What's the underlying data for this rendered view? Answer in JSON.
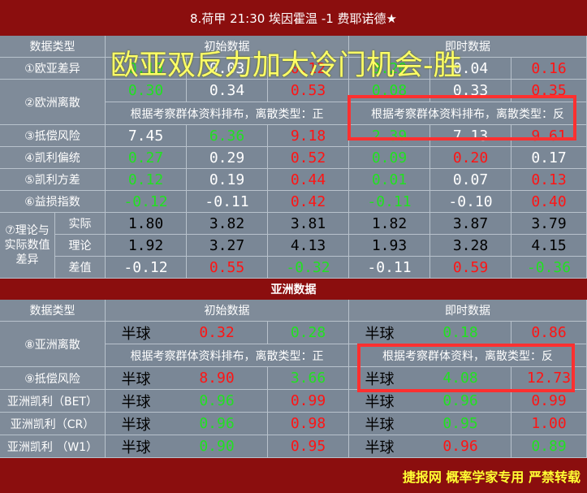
{
  "header": {
    "title": "8.荷甲 21:30 埃因霍温 -1 费耶诺德★"
  },
  "overlay_text": "欧亚双反力加大冷门机会-胜",
  "europe": {
    "col_labels": {
      "type": "数据类型",
      "initial": "初始数据",
      "live": "即时数据"
    },
    "rows": [
      {
        "label": "①欧亚差异",
        "cells": [
          {
            "v": "0.10",
            "c": "green"
          },
          {
            "v": "0.03",
            "c": "white"
          },
          {
            "v": "0.12",
            "c": "red"
          },
          {
            "v": "0.20",
            "c": "green"
          },
          {
            "v": "0.04",
            "c": "white"
          },
          {
            "v": "0.16",
            "c": "red"
          }
        ]
      },
      {
        "label": "②欧洲离散",
        "cells": [
          {
            "v": "0.30",
            "c": "green"
          },
          {
            "v": "0.34",
            "c": "white"
          },
          {
            "v": "0.53",
            "c": "red"
          },
          {
            "v": "0.08",
            "c": "green"
          },
          {
            "v": "0.33",
            "c": "white"
          },
          {
            "v": "0.35",
            "c": "red"
          }
        ],
        "notes": [
          "根据考察群体资料排布，离散类型：正",
          "根据考察群体资料排布，离散类型：反"
        ]
      },
      {
        "label": "③抵偿风险",
        "cells": [
          {
            "v": "7.45",
            "c": "white"
          },
          {
            "v": "6.36",
            "c": "green"
          },
          {
            "v": "9.18",
            "c": "red"
          },
          {
            "v": "2.39",
            "c": "green"
          },
          {
            "v": "7.13",
            "c": "white"
          },
          {
            "v": "9.61",
            "c": "red"
          }
        ]
      },
      {
        "label": "④凯利偏统",
        "cells": [
          {
            "v": "0.27",
            "c": "green"
          },
          {
            "v": "0.29",
            "c": "white"
          },
          {
            "v": "0.52",
            "c": "red"
          },
          {
            "v": "0.09",
            "c": "green"
          },
          {
            "v": "0.20",
            "c": "red"
          },
          {
            "v": "0.17",
            "c": "white"
          }
        ]
      },
      {
        "label": "⑤凯利方差",
        "cells": [
          {
            "v": "0.12",
            "c": "green"
          },
          {
            "v": "0.19",
            "c": "white"
          },
          {
            "v": "0.44",
            "c": "red"
          },
          {
            "v": "0.01",
            "c": "green"
          },
          {
            "v": "0.07",
            "c": "white"
          },
          {
            "v": "0.13",
            "c": "red"
          }
        ]
      },
      {
        "label": "⑥益损指数",
        "cells": [
          {
            "v": "-0.12",
            "c": "green"
          },
          {
            "v": "-0.11",
            "c": "white"
          },
          {
            "v": "0.42",
            "c": "red"
          },
          {
            "v": "-0.11",
            "c": "green"
          },
          {
            "v": "-0.10",
            "c": "white"
          },
          {
            "v": "0.40",
            "c": "red"
          }
        ]
      }
    ],
    "theory": {
      "label": "⑦理论与实际数值差异",
      "rows": [
        {
          "label": "实际",
          "cells": [
            {
              "v": "1.80",
              "c": "black"
            },
            {
              "v": "3.82",
              "c": "black"
            },
            {
              "v": "3.81",
              "c": "black"
            },
            {
              "v": "1.82",
              "c": "black"
            },
            {
              "v": "3.87",
              "c": "black"
            },
            {
              "v": "3.79",
              "c": "black"
            }
          ]
        },
        {
          "label": "理论",
          "cells": [
            {
              "v": "1.92",
              "c": "black"
            },
            {
              "v": "3.27",
              "c": "black"
            },
            {
              "v": "4.13",
              "c": "black"
            },
            {
              "v": "1.93",
              "c": "black"
            },
            {
              "v": "3.28",
              "c": "black"
            },
            {
              "v": "4.15",
              "c": "black"
            }
          ]
        },
        {
          "label": "差值",
          "cells": [
            {
              "v": "-0.12",
              "c": "white"
            },
            {
              "v": "0.55",
              "c": "red"
            },
            {
              "v": "-0.32",
              "c": "green"
            },
            {
              "v": "-0.11",
              "c": "white"
            },
            {
              "v": "0.59",
              "c": "red"
            },
            {
              "v": "-0.36",
              "c": "green"
            }
          ]
        }
      ]
    }
  },
  "asia": {
    "section_title": "亚洲数据",
    "col_labels": {
      "type": "数据类型",
      "initial": "初始数据",
      "live": "即时数据"
    },
    "rows": [
      {
        "label": "⑧亚洲离散",
        "ball_init": "半球",
        "ball_live": "半球",
        "cells": [
          {
            "v": "0.32",
            "c": "red"
          },
          {
            "v": "0.28",
            "c": "green"
          },
          {
            "v": "0.18",
            "c": "green"
          },
          {
            "v": "0.86",
            "c": "red"
          }
        ],
        "notes": [
          "根据考察群体资料排布，离散类型：正",
          "根据考察群体资料，离散类型：反"
        ]
      },
      {
        "label": "⑨抵偿风险",
        "ball_init": "半球",
        "ball_live": "半球",
        "cells": [
          {
            "v": "8.90",
            "c": "red"
          },
          {
            "v": "3.66",
            "c": "green"
          },
          {
            "v": "4.08",
            "c": "green"
          },
          {
            "v": "12.73",
            "c": "red"
          }
        ]
      },
      {
        "label": "亚洲凯利（BET）",
        "ball_init": "半球",
        "ball_live": "半球",
        "cells": [
          {
            "v": "0.96",
            "c": "green"
          },
          {
            "v": "0.99",
            "c": "red"
          },
          {
            "v": "0.96",
            "c": "green"
          },
          {
            "v": "0.99",
            "c": "red"
          }
        ]
      },
      {
        "label": "亚洲凯利（CR）",
        "ball_init": "半球",
        "ball_live": "半球",
        "cells": [
          {
            "v": "0.96",
            "c": "green"
          },
          {
            "v": "0.98",
            "c": "red"
          },
          {
            "v": "0.95",
            "c": "green"
          },
          {
            "v": "1.00",
            "c": "red"
          }
        ]
      },
      {
        "label": "亚洲凯利 （W1）",
        "ball_init": "半球",
        "ball_live": "半球",
        "cells": [
          {
            "v": "0.90",
            "c": "green"
          },
          {
            "v": "0.95",
            "c": "red"
          },
          {
            "v": "0.96",
            "c": "red"
          },
          {
            "v": "0.89",
            "c": "green"
          }
        ]
      }
    ]
  },
  "footer": {
    "text": "捷报网 概率学家专用 严禁转载"
  },
  "colors": {
    "header_bg": "#8b0e0e",
    "cell_bg": "#7a8796",
    "green": "#22e022",
    "red": "#ff1414",
    "footer_text": "#ffff33",
    "highlight_box": "#ff3030"
  }
}
